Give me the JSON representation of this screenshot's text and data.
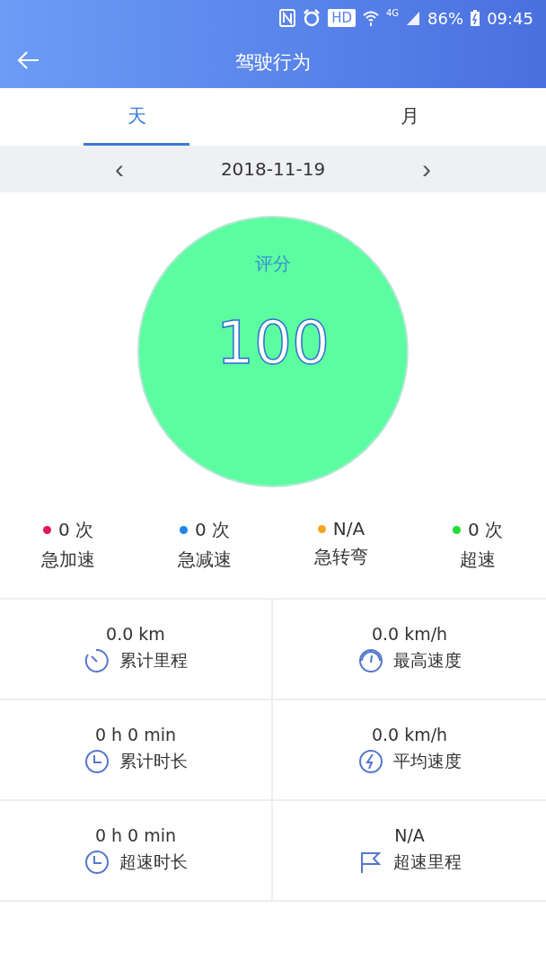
{
  "status_bar": {
    "hd": "HD",
    "network": "4G",
    "battery": "86%",
    "time": "09:45"
  },
  "header": {
    "title": "驾驶行为"
  },
  "tabs": [
    {
      "label": "天",
      "selected": true
    },
    {
      "label": "月",
      "selected": false
    }
  ],
  "date_nav": {
    "prev": "‹",
    "date": "2018-11-19",
    "next": "›"
  },
  "score": {
    "label": "评分",
    "value": "100"
  },
  "events": [
    {
      "count": "0 次",
      "label": "急加速",
      "color": "#e0185a"
    },
    {
      "count": "0 次",
      "label": "急减速",
      "color": "#1e88e5"
    },
    {
      "count": "N/A",
      "label": "急转弯",
      "color": "#f5a623"
    },
    {
      "count": "0 次",
      "label": "超速",
      "color": "#22dd33"
    }
  ],
  "stats": [
    {
      "value": "0.0 km",
      "label": "累计里程",
      "kind": "stopwatch"
    },
    {
      "value": "0.0 km/h",
      "label": "最高速度",
      "kind": "gauge"
    },
    {
      "value": "0 h 0 min",
      "label": "累计时长",
      "kind": "clock"
    },
    {
      "value": "0.0 km/h",
      "label": "平均速度",
      "kind": "bolt"
    },
    {
      "value": "0 h 0 min",
      "label": "超速时长",
      "kind": "clock"
    },
    {
      "value": "N/A",
      "label": "超速里程",
      "kind": "flag"
    }
  ]
}
